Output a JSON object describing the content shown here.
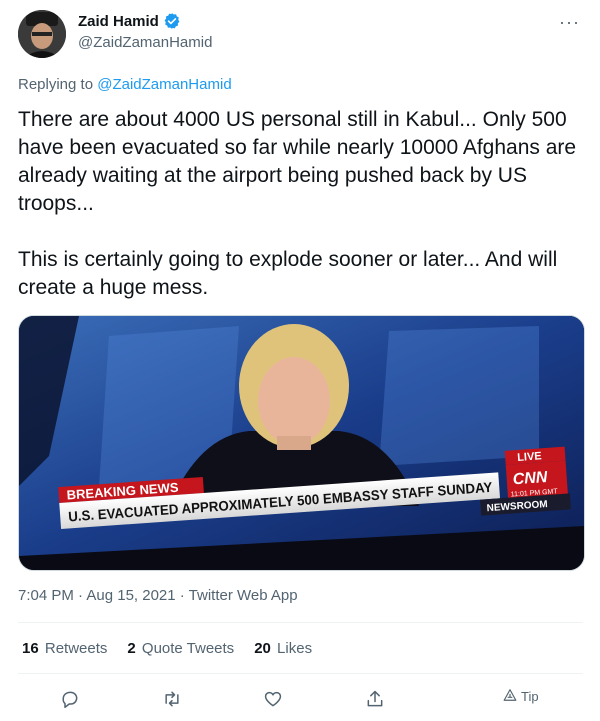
{
  "author": {
    "display_name": "Zaid Hamid",
    "handle": "@ZaidZamanHamid",
    "verified": true
  },
  "reply": {
    "prefix": "Replying to ",
    "to": "@ZaidZamanHamid"
  },
  "tweet": {
    "text": "There are about 4000 US personal still in Kabul... Only 500 have been evacuated so far while nearly 10000 Afghans are already waiting at the airport being pushed back by US troops...\n\nThis is certainly going to explode sooner or later... And will create a huge mess.",
    "timestamp": "7:04 PM · Aug 15, 2021 · Twitter Web App"
  },
  "media": {
    "breaking_label": "BREAKING NEWS",
    "headline": "U.S. EVACUATED APPROXIMATELY 500 EMBASSY STAFF SUNDAY",
    "live_label": "LIVE",
    "network": "CNN",
    "time": "11:01 PM GMT",
    "show": "NEWSROOM"
  },
  "stats": {
    "retweets_count": "16",
    "retweets_label": "Retweets",
    "quotes_count": "2",
    "quotes_label": "Quote Tweets",
    "likes_count": "20",
    "likes_label": "Likes"
  },
  "actions": {
    "tip_label": "Tip",
    "icons": [
      "reply-icon",
      "retweet-icon",
      "like-icon",
      "share-icon",
      "tip-icon"
    ]
  },
  "colors": {
    "link": "#1d9bf0",
    "secondary_text": "#536471",
    "primary_text": "#0f1419",
    "breaking_red": "#c4161c"
  }
}
